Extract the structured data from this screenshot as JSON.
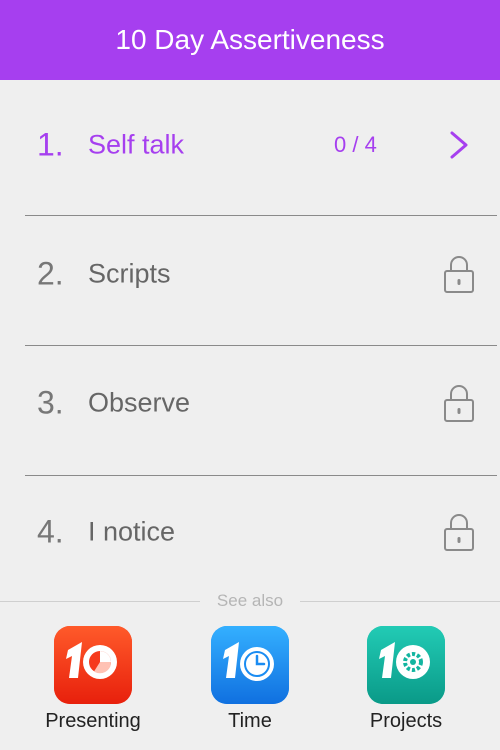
{
  "header": {
    "title": "10 Day Assertiveness"
  },
  "steps": [
    {
      "number": "1.",
      "label": "Self talk",
      "progress": "0 / 4",
      "state": "active",
      "icon": "chevron-right-icon"
    },
    {
      "number": "2.",
      "label": "Scripts",
      "state": "locked",
      "icon": "lock-icon"
    },
    {
      "number": "3.",
      "label": "Observe",
      "state": "locked",
      "icon": "lock-icon"
    },
    {
      "number": "4.",
      "label": "I notice",
      "state": "locked",
      "icon": "lock-icon"
    }
  ],
  "see_also": {
    "label": "See also",
    "apps": [
      {
        "name": "Presenting",
        "icon": "presenting-app-icon",
        "color": "#f63a1c"
      },
      {
        "name": "Time",
        "icon": "time-app-icon",
        "color": "#1a8cf2"
      },
      {
        "name": "Projects",
        "icon": "projects-app-icon",
        "color": "#12b5a0"
      }
    ]
  },
  "colors": {
    "accent": "#a63fef",
    "background": "#efefef",
    "locked_text": "#666666"
  }
}
